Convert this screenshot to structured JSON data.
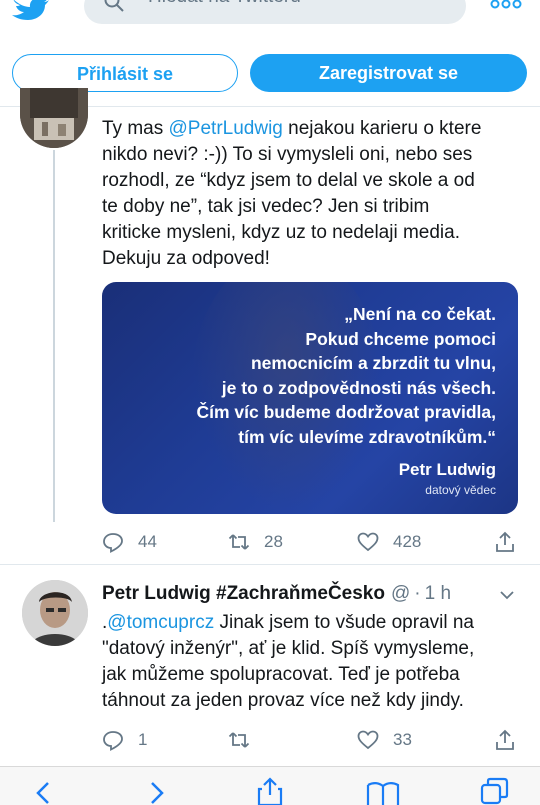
{
  "search": {
    "placeholder": "Hledat na Twitteru"
  },
  "auth": {
    "login_label": "Přihlásit se",
    "signup_label": "Zaregistrovat se"
  },
  "tweet1": {
    "text_before": "Ty mas ",
    "mention": "@PetrLudwig",
    "text_after": " nejakou karieru o ktere\nnikdo nevi? :-)) To si vymysleli oni, nebo ses\nrozhodl, ze “kdyz jsem to delal ve skole a od\nte doby ne”, tak jsi vedec? Jen si tribim\nkriticke mysleni, kdyz uz to nedelaji media.\nDekuju za odpoved!",
    "media": {
      "quote": "„Není na co čekat.\nPokud chceme pomoci\nnemocnicím a zbrzdit tu vlnu,\nje to o zodpovědnosti nás všech.\nČím víc budeme dodržovat pravidla,\ntím víc ulevíme zdravotníkům.“",
      "author": "Petr Ludwig",
      "role": "datový vědec"
    },
    "replies": "44",
    "retweets": "28",
    "likes": "428"
  },
  "tweet2": {
    "name": "Petr Ludwig #ZachraňmeČesko",
    "handle": "@",
    "dot": "·",
    "time": "1 h",
    "text_prefix": ".",
    "mention": "@tomcuprcz",
    "text_after": " Jinak jsem to všude opravil na\n\"datový inženýr\", ať je klid. Spíš vymysleme,\njak můžeme spolupracovat. Teď je potřeba\ntáhnout za jeden provaz více než kdy jindy.",
    "replies": "1",
    "retweets": "",
    "likes": "33"
  },
  "colors": {
    "accent": "#1da1f2",
    "mention": "#1b95e0",
    "muted": "#657786"
  },
  "icons": [
    "twitter-logo-icon",
    "search-icon",
    "more-icon",
    "reply-icon",
    "retweet-icon",
    "like-icon",
    "share-icon",
    "caret-down-icon",
    "back-icon",
    "forward-icon",
    "share-safari-icon",
    "bookmarks-icon",
    "tabs-icon"
  ]
}
